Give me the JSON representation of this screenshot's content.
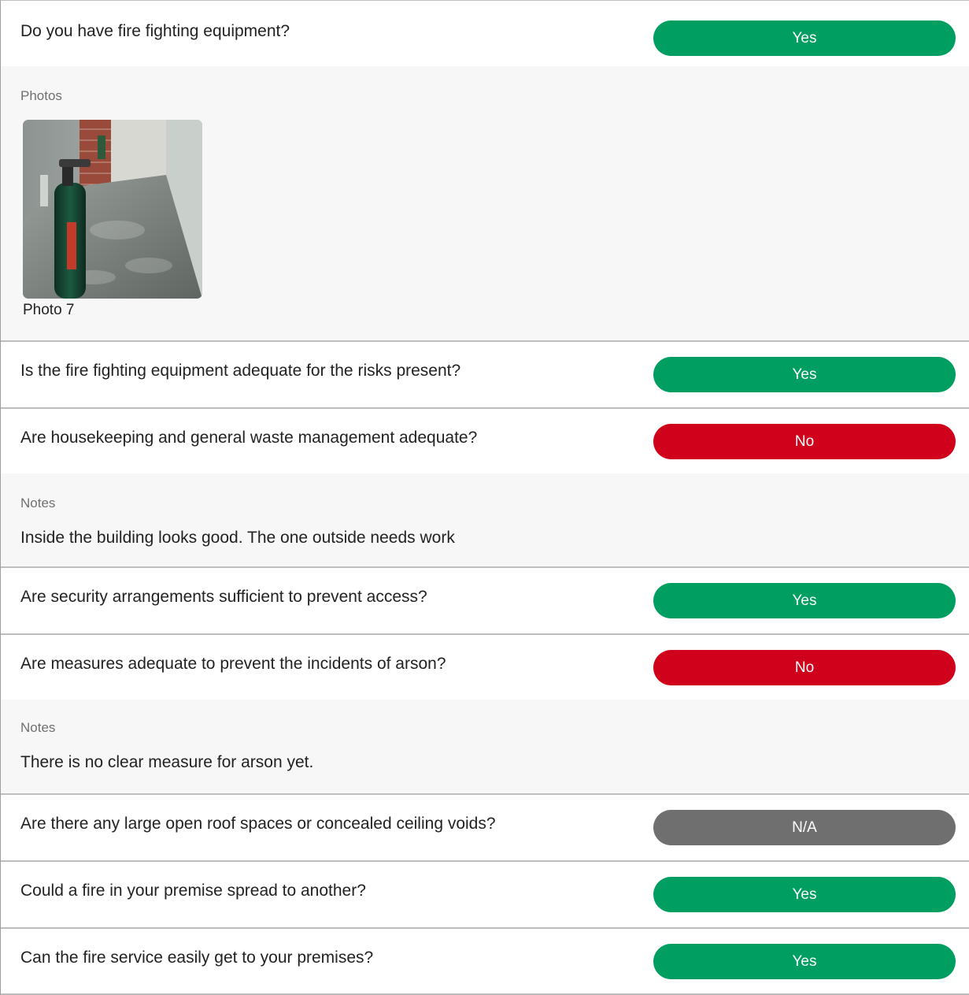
{
  "colors": {
    "yes": "#009e60",
    "no": "#d0021b",
    "na": "#6f6f6f"
  },
  "items": [
    {
      "question": "Do you have fire fighting equipment?",
      "answer": "Yes",
      "detail": {
        "label": "Photos",
        "photo_caption": "Photo 7"
      }
    },
    {
      "question": "Is the fire fighting equipment adequate for the risks present?",
      "answer": "Yes"
    },
    {
      "question": "Are housekeeping and general waste management adequate?",
      "answer": "No",
      "detail": {
        "label": "Notes",
        "text": "Inside the building looks good. The one outside needs work"
      }
    },
    {
      "question": "Are security arrangements sufficient to prevent access?",
      "answer": "Yes"
    },
    {
      "question": "Are measures adequate to prevent the incidents of arson?",
      "answer": "No",
      "detail": {
        "label": "Notes",
        "text": "There is no clear measure for arson yet."
      }
    },
    {
      "question": "Are there any large open roof spaces or concealed ceiling voids?",
      "answer": "N/A"
    },
    {
      "question": "Could a fire in your premise spread to another?",
      "answer": "Yes"
    },
    {
      "question": "Can the fire service easily get to your premises?",
      "answer": "Yes"
    }
  ]
}
